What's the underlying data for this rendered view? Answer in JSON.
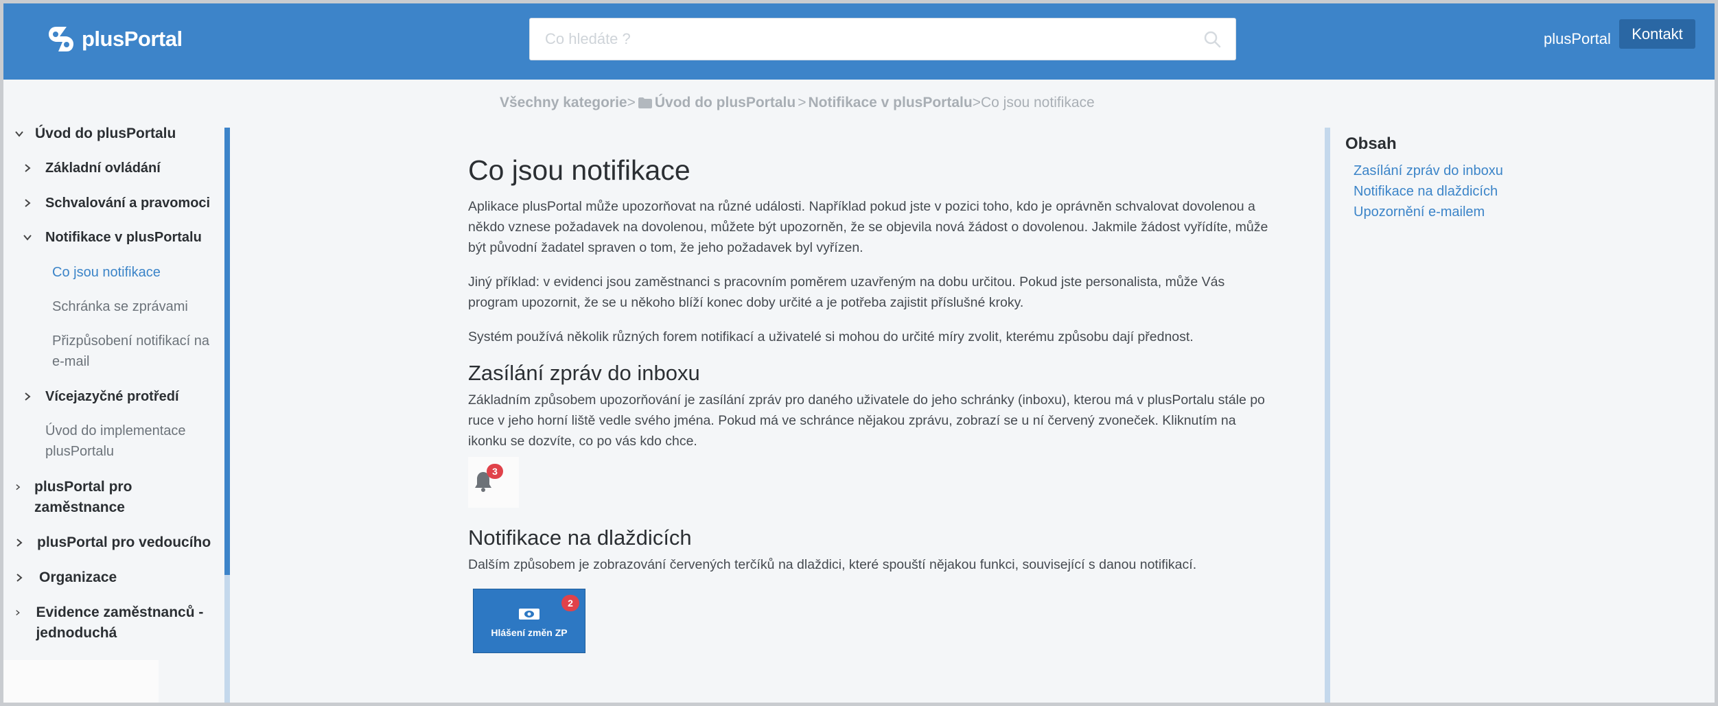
{
  "header": {
    "brand": "plusPortal",
    "search_placeholder": "Co hledáte ?",
    "portal_link": "plusPortal",
    "contact_label": "Kontakt",
    "brand_color": "#3d84c9"
  },
  "breadcrumb": {
    "all": "Všechny kategorie",
    "sep1": ">",
    "level1": "Úvod do plusPortalu",
    "sep2": ">",
    "level2": "Notifikace v plusPortalu",
    "sep3": ">",
    "current": "Co jsou notifikace"
  },
  "sidebar": {
    "items": [
      {
        "label": "Úvod do plusPortalu",
        "expanded": true
      },
      {
        "label": "Základní ovládání",
        "expanded": false
      },
      {
        "label": "Schvalování a pravomoci",
        "expanded": false
      },
      {
        "label": "Notifikace v plusPortalu",
        "expanded": true
      },
      {
        "label": "Co jsou notifikace",
        "active": true
      },
      {
        "label": "Schránka se zprávami"
      },
      {
        "label": "Přizpůsobení notifikací na e-mail"
      },
      {
        "label": "Vícejazyčné protředí",
        "expanded": false
      },
      {
        "label": "Úvod do implementace plusPortalu"
      },
      {
        "label": "plusPortal pro zaměstnance",
        "expanded": false
      },
      {
        "label": "plusPortal pro vedoucího",
        "expanded": false
      },
      {
        "label": "Organizace",
        "expanded": false
      },
      {
        "label": "Evidence zaměstnanců - jednoduchá",
        "expanded": false
      }
    ]
  },
  "article": {
    "title": "Co jsou notifikace",
    "intro_p1": "Aplikace plusPortal může upozorňovat na různé události. Například pokud jste v pozici toho, kdo je oprávněn schvalovat dovolenou a někdo vznese požadavek na dovolenou, můžete být upozorněn, že se objevila nová žádost o dovolenou. Jakmile žádost vyřídíte, může být původní žadatel spraven o tom, že jeho požadavek byl vyřízen.",
    "intro_p2": "Jiný příklad: v evidenci jsou zaměstnanci s pracovním poměrem uzavřeným na dobu určitou. Pokud jste personalista, může Vás program upozornit, že se u někoho blíží konec doby určité a je potřeba zajistit příslušné kroky.",
    "intro_p3": "Systém používá několik různých forem notifikací a uživatelé si mohou do určité míry zvolit, kterému způsobu dají přednost.",
    "section1_title": "Zasílání zpráv do inboxu",
    "section1_text": "Základním způsobem upozorňování je zasílání zpráv pro daného uživatele do jeho schránky (inboxu), kterou má v plusPortalu stále po ruce v jeho horní liště vedle svého jména. Pokud má ve schránce nějakou zprávu, zobrazí se u ní červený zvoneček. Kliknutím na ikonku se dozvíte, co po vás kdo chce.",
    "bell_count": "3",
    "section2_title": "Notifikace na dlaždicích",
    "section2_text": "Dalším způsobem je zobrazování červených terčíků na dlaždici, které spouští nějakou funkci, související s danou notifikací.",
    "tile_label": "Hlášení změn ZP",
    "tile_count": "2",
    "badge_color": "#e0424a"
  },
  "toc": {
    "title": "Obsah",
    "items": [
      "Zasílání zpráv do inboxu",
      "Notifikace na dlaždicích",
      "Upozornění e-mailem"
    ]
  }
}
